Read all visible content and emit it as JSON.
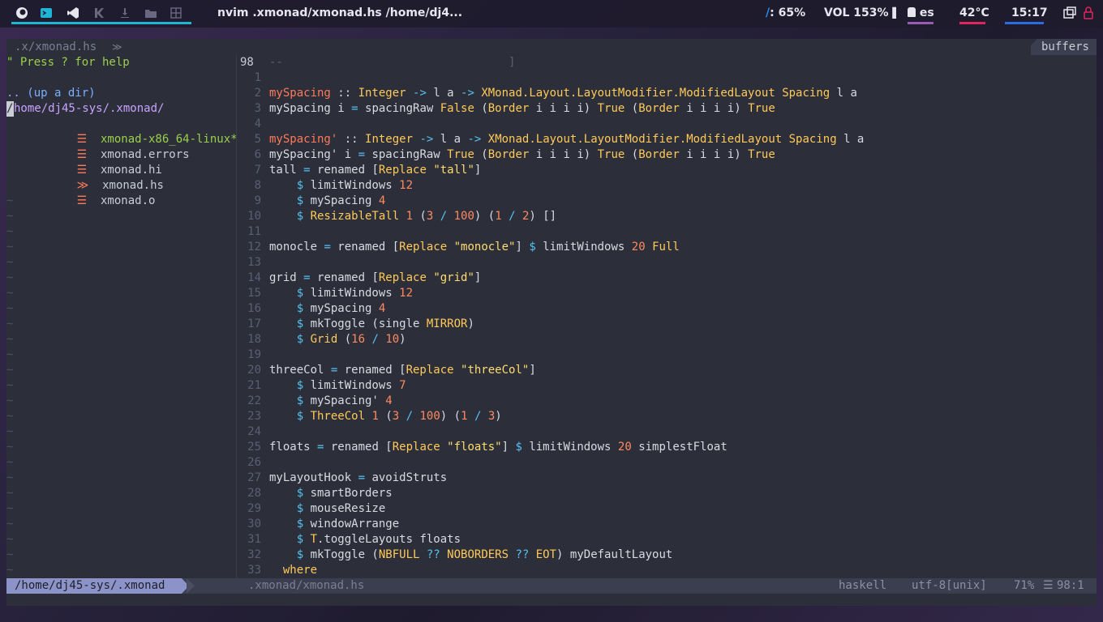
{
  "topbar": {
    "window_title": "nvim .xmonad/xmonad.hs /home/dj4...",
    "brightness_icon": "/",
    "brightness": ": 65%",
    "volume": "VOL 153%",
    "volume_bar": "▌",
    "keyboard_layout": "es",
    "temperature": "42°C",
    "clock": "15:17",
    "colors": {
      "accent": "#1fb5d6",
      "layout": "#9b59b6",
      "temp": "#e0245e",
      "clock": "#2d6be4"
    }
  },
  "tabline": {
    "left": ".x/xmonad.hs",
    "right": "buffers"
  },
  "tree": {
    "help": "\" Press ? for help",
    "updir": ".. (up a dir)",
    "cursor_char": "/",
    "path": "home/dj45-sys/.xmonad/",
    "files": [
      {
        "name": "xmonad-x86_64-linux*",
        "icon": "file-icon"
      },
      {
        "name": "xmonad.errors",
        "icon": "file-icon"
      },
      {
        "name": "xmonad.hi",
        "icon": "file-icon"
      },
      {
        "name": "xmonad.hs",
        "icon": "haskell-icon"
      },
      {
        "name": "xmonad.o",
        "icon": "file-icon"
      }
    ]
  },
  "code": {
    "top_line_no": "98",
    "top_line_text": "--                                 ]",
    "line_numbers": [
      "1",
      "2",
      "3",
      "4",
      "5",
      "6",
      "7",
      "8",
      "9",
      "10",
      "11",
      "12",
      "13",
      "14",
      "15",
      "16",
      "17",
      "18",
      "19",
      "20",
      "21",
      "22",
      "23",
      "24",
      "25",
      "26",
      "27",
      "28",
      "29",
      "30",
      "31",
      "32",
      "33"
    ],
    "lines": [
      [],
      [
        [
          "kw",
          "mySpacing"
        ],
        [
          "plain",
          " :: "
        ],
        [
          "type",
          "Integer"
        ],
        [
          "op",
          " -> "
        ],
        [
          "plain",
          "l a "
        ],
        [
          "op",
          "-> "
        ],
        [
          "type",
          "XMonad.Layout.LayoutModifier.ModifiedLayout Spacing"
        ],
        [
          "plain",
          " l a"
        ]
      ],
      [
        [
          "plain",
          "mySpacing i "
        ],
        [
          "op",
          "= "
        ],
        [
          "plain",
          "spacingRaw "
        ],
        [
          "type",
          "False"
        ],
        [
          "plain",
          " ("
        ],
        [
          "type",
          "Border"
        ],
        [
          "plain",
          " i i i i) "
        ],
        [
          "type",
          "True"
        ],
        [
          "plain",
          " ("
        ],
        [
          "type",
          "Border"
        ],
        [
          "plain",
          " i i i i) "
        ],
        [
          "type",
          "True"
        ]
      ],
      [],
      [
        [
          "kw",
          "mySpacing'"
        ],
        [
          "plain",
          " :: "
        ],
        [
          "type",
          "Integer"
        ],
        [
          "op",
          " -> "
        ],
        [
          "plain",
          "l a "
        ],
        [
          "op",
          "-> "
        ],
        [
          "type",
          "XMonad.Layout.LayoutModifier.ModifiedLayout Spacing"
        ],
        [
          "plain",
          " l a"
        ]
      ],
      [
        [
          "plain",
          "mySpacing' i "
        ],
        [
          "op",
          "= "
        ],
        [
          "plain",
          "spacingRaw "
        ],
        [
          "type",
          "True"
        ],
        [
          "plain",
          " ("
        ],
        [
          "type",
          "Border"
        ],
        [
          "plain",
          " i i i i) "
        ],
        [
          "type",
          "True"
        ],
        [
          "plain",
          " ("
        ],
        [
          "type",
          "Border"
        ],
        [
          "plain",
          " i i i i) "
        ],
        [
          "type",
          "True"
        ]
      ],
      [
        [
          "plain",
          "tall "
        ],
        [
          "op",
          "= "
        ],
        [
          "plain",
          "renamed ["
        ],
        [
          "type",
          "Replace"
        ],
        [
          "str",
          " \"tall\""
        ],
        [
          "plain",
          "]"
        ]
      ],
      [
        [
          "op",
          "    $ "
        ],
        [
          "plain",
          "limitWindows "
        ],
        [
          "num",
          "12"
        ]
      ],
      [
        [
          "op",
          "    $ "
        ],
        [
          "plain",
          "mySpacing "
        ],
        [
          "num",
          "4"
        ]
      ],
      [
        [
          "op",
          "    $ "
        ],
        [
          "type",
          "ResizableTall"
        ],
        [
          "num",
          " 1 "
        ],
        [
          "plain",
          "("
        ],
        [
          "num",
          "3"
        ],
        [
          "op",
          " / "
        ],
        [
          "num",
          "100"
        ],
        [
          "plain",
          ") ("
        ],
        [
          "num",
          "1"
        ],
        [
          "op",
          " / "
        ],
        [
          "num",
          "2"
        ],
        [
          "plain",
          ") []"
        ]
      ],
      [],
      [
        [
          "plain",
          "monocle "
        ],
        [
          "op",
          "= "
        ],
        [
          "plain",
          "renamed ["
        ],
        [
          "type",
          "Replace"
        ],
        [
          "str",
          " \"monocle\""
        ],
        [
          "plain",
          "] "
        ],
        [
          "op",
          "$ "
        ],
        [
          "plain",
          "limitWindows "
        ],
        [
          "num",
          "20 "
        ],
        [
          "type",
          "Full"
        ]
      ],
      [],
      [
        [
          "plain",
          "grid "
        ],
        [
          "op",
          "= "
        ],
        [
          "plain",
          "renamed ["
        ],
        [
          "type",
          "Replace"
        ],
        [
          "str",
          " \"grid\""
        ],
        [
          "plain",
          "]"
        ]
      ],
      [
        [
          "op",
          "    $ "
        ],
        [
          "plain",
          "limitWindows "
        ],
        [
          "num",
          "12"
        ]
      ],
      [
        [
          "op",
          "    $ "
        ],
        [
          "plain",
          "mySpacing "
        ],
        [
          "num",
          "4"
        ]
      ],
      [
        [
          "op",
          "    $ "
        ],
        [
          "plain",
          "mkToggle (single "
        ],
        [
          "type",
          "MIRROR"
        ],
        [
          "plain",
          ")"
        ]
      ],
      [
        [
          "op",
          "    $ "
        ],
        [
          "type",
          "Grid"
        ],
        [
          "plain",
          " ("
        ],
        [
          "num",
          "16"
        ],
        [
          "op",
          " / "
        ],
        [
          "num",
          "10"
        ],
        [
          "plain",
          ")"
        ]
      ],
      [],
      [
        [
          "plain",
          "threeCol "
        ],
        [
          "op",
          "= "
        ],
        [
          "plain",
          "renamed ["
        ],
        [
          "type",
          "Replace"
        ],
        [
          "str",
          " \"threeCol\""
        ],
        [
          "plain",
          "]"
        ]
      ],
      [
        [
          "op",
          "    $ "
        ],
        [
          "plain",
          "limitWindows "
        ],
        [
          "num",
          "7"
        ]
      ],
      [
        [
          "op",
          "    $ "
        ],
        [
          "plain",
          "mySpacing' "
        ],
        [
          "num",
          "4"
        ]
      ],
      [
        [
          "op",
          "    $ "
        ],
        [
          "type",
          "ThreeCol"
        ],
        [
          "num",
          " 1 "
        ],
        [
          "plain",
          "("
        ],
        [
          "num",
          "3"
        ],
        [
          "op",
          " / "
        ],
        [
          "num",
          "100"
        ],
        [
          "plain",
          ") ("
        ],
        [
          "num",
          "1"
        ],
        [
          "op",
          " / "
        ],
        [
          "num",
          "3"
        ],
        [
          "plain",
          ")"
        ]
      ],
      [],
      [
        [
          "plain",
          "floats "
        ],
        [
          "op",
          "= "
        ],
        [
          "plain",
          "renamed ["
        ],
        [
          "type",
          "Replace"
        ],
        [
          "str",
          " \"floats\""
        ],
        [
          "plain",
          "] "
        ],
        [
          "op",
          "$ "
        ],
        [
          "plain",
          "limitWindows "
        ],
        [
          "num",
          "20 "
        ],
        [
          "plain",
          "simplestFloat"
        ]
      ],
      [],
      [
        [
          "plain",
          "myLayoutHook "
        ],
        [
          "op",
          "= "
        ],
        [
          "plain",
          "avoidStruts"
        ]
      ],
      [
        [
          "op",
          "    $ "
        ],
        [
          "plain",
          "smartBorders"
        ]
      ],
      [
        [
          "op",
          "    $ "
        ],
        [
          "plain",
          "mouseResize"
        ]
      ],
      [
        [
          "op",
          "    $ "
        ],
        [
          "plain",
          "windowArrange"
        ]
      ],
      [
        [
          "op",
          "    $ "
        ],
        [
          "type",
          "T"
        ],
        [
          "plain",
          ".toggleLayouts floats"
        ]
      ],
      [
        [
          "op",
          "    $ "
        ],
        [
          "plain",
          "mkToggle ("
        ],
        [
          "type",
          "NBFULL"
        ],
        [
          "op",
          " ?? "
        ],
        [
          "type",
          "NOBORDERS"
        ],
        [
          "op",
          " ?? "
        ],
        [
          "type",
          "EOT"
        ],
        [
          "plain",
          ") myDefaultLayout"
        ]
      ],
      [
        [
          "type",
          "  where"
        ]
      ]
    ]
  },
  "statusline": {
    "tree_path": "/home/dj45-sys/.xmonad",
    "file": ".xmonad/xmonad.hs",
    "filetype": "haskell",
    "encoding": "utf-8[unix]",
    "percent": "71%",
    "position": "98:1"
  }
}
